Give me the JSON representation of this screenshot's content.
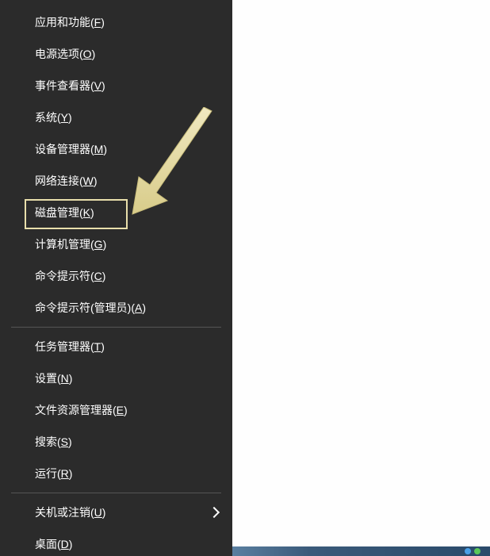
{
  "menu": {
    "group1": [
      {
        "label": "应用和功能(",
        "shortcut": "F",
        "suffix": ")",
        "name": "menu-apps-features"
      },
      {
        "label": "电源选项(",
        "shortcut": "O",
        "suffix": ")",
        "name": "menu-power-options"
      },
      {
        "label": "事件查看器(",
        "shortcut": "V",
        "suffix": ")",
        "name": "menu-event-viewer"
      },
      {
        "label": "系统(",
        "shortcut": "Y",
        "suffix": ")",
        "name": "menu-system"
      },
      {
        "label": "设备管理器(",
        "shortcut": "M",
        "suffix": ")",
        "name": "menu-device-manager"
      },
      {
        "label": "网络连接(",
        "shortcut": "W",
        "suffix": ")",
        "name": "menu-network"
      },
      {
        "label": "磁盘管理(",
        "shortcut": "K",
        "suffix": ")",
        "name": "menu-disk-management",
        "highlighted": true
      },
      {
        "label": "计算机管理(",
        "shortcut": "G",
        "suffix": ")",
        "name": "menu-computer-management"
      },
      {
        "label": "命令提示符(",
        "shortcut": "C",
        "suffix": ")",
        "name": "menu-cmd"
      },
      {
        "label": "命令提示符(管理员)(",
        "shortcut": "A",
        "suffix": ")",
        "name": "menu-cmd-admin"
      }
    ],
    "group2": [
      {
        "label": "任务管理器(",
        "shortcut": "T",
        "suffix": ")",
        "name": "menu-task-manager"
      },
      {
        "label": "设置(",
        "shortcut": "N",
        "suffix": ")",
        "name": "menu-settings"
      },
      {
        "label": "文件资源管理器(",
        "shortcut": "E",
        "suffix": ")",
        "name": "menu-explorer"
      },
      {
        "label": "搜索(",
        "shortcut": "S",
        "suffix": ")",
        "name": "menu-search"
      },
      {
        "label": "运行(",
        "shortcut": "R",
        "suffix": ")",
        "name": "menu-run"
      }
    ],
    "group3": [
      {
        "label": "关机或注销(",
        "shortcut": "U",
        "suffix": ")",
        "name": "menu-shutdown",
        "arrow": true
      },
      {
        "label": "桌面(",
        "shortcut": "D",
        "suffix": ")",
        "name": "menu-desktop"
      }
    ]
  },
  "annotation": {
    "highlight_color": "#e8deab",
    "arrow_color": "#e8deab"
  }
}
